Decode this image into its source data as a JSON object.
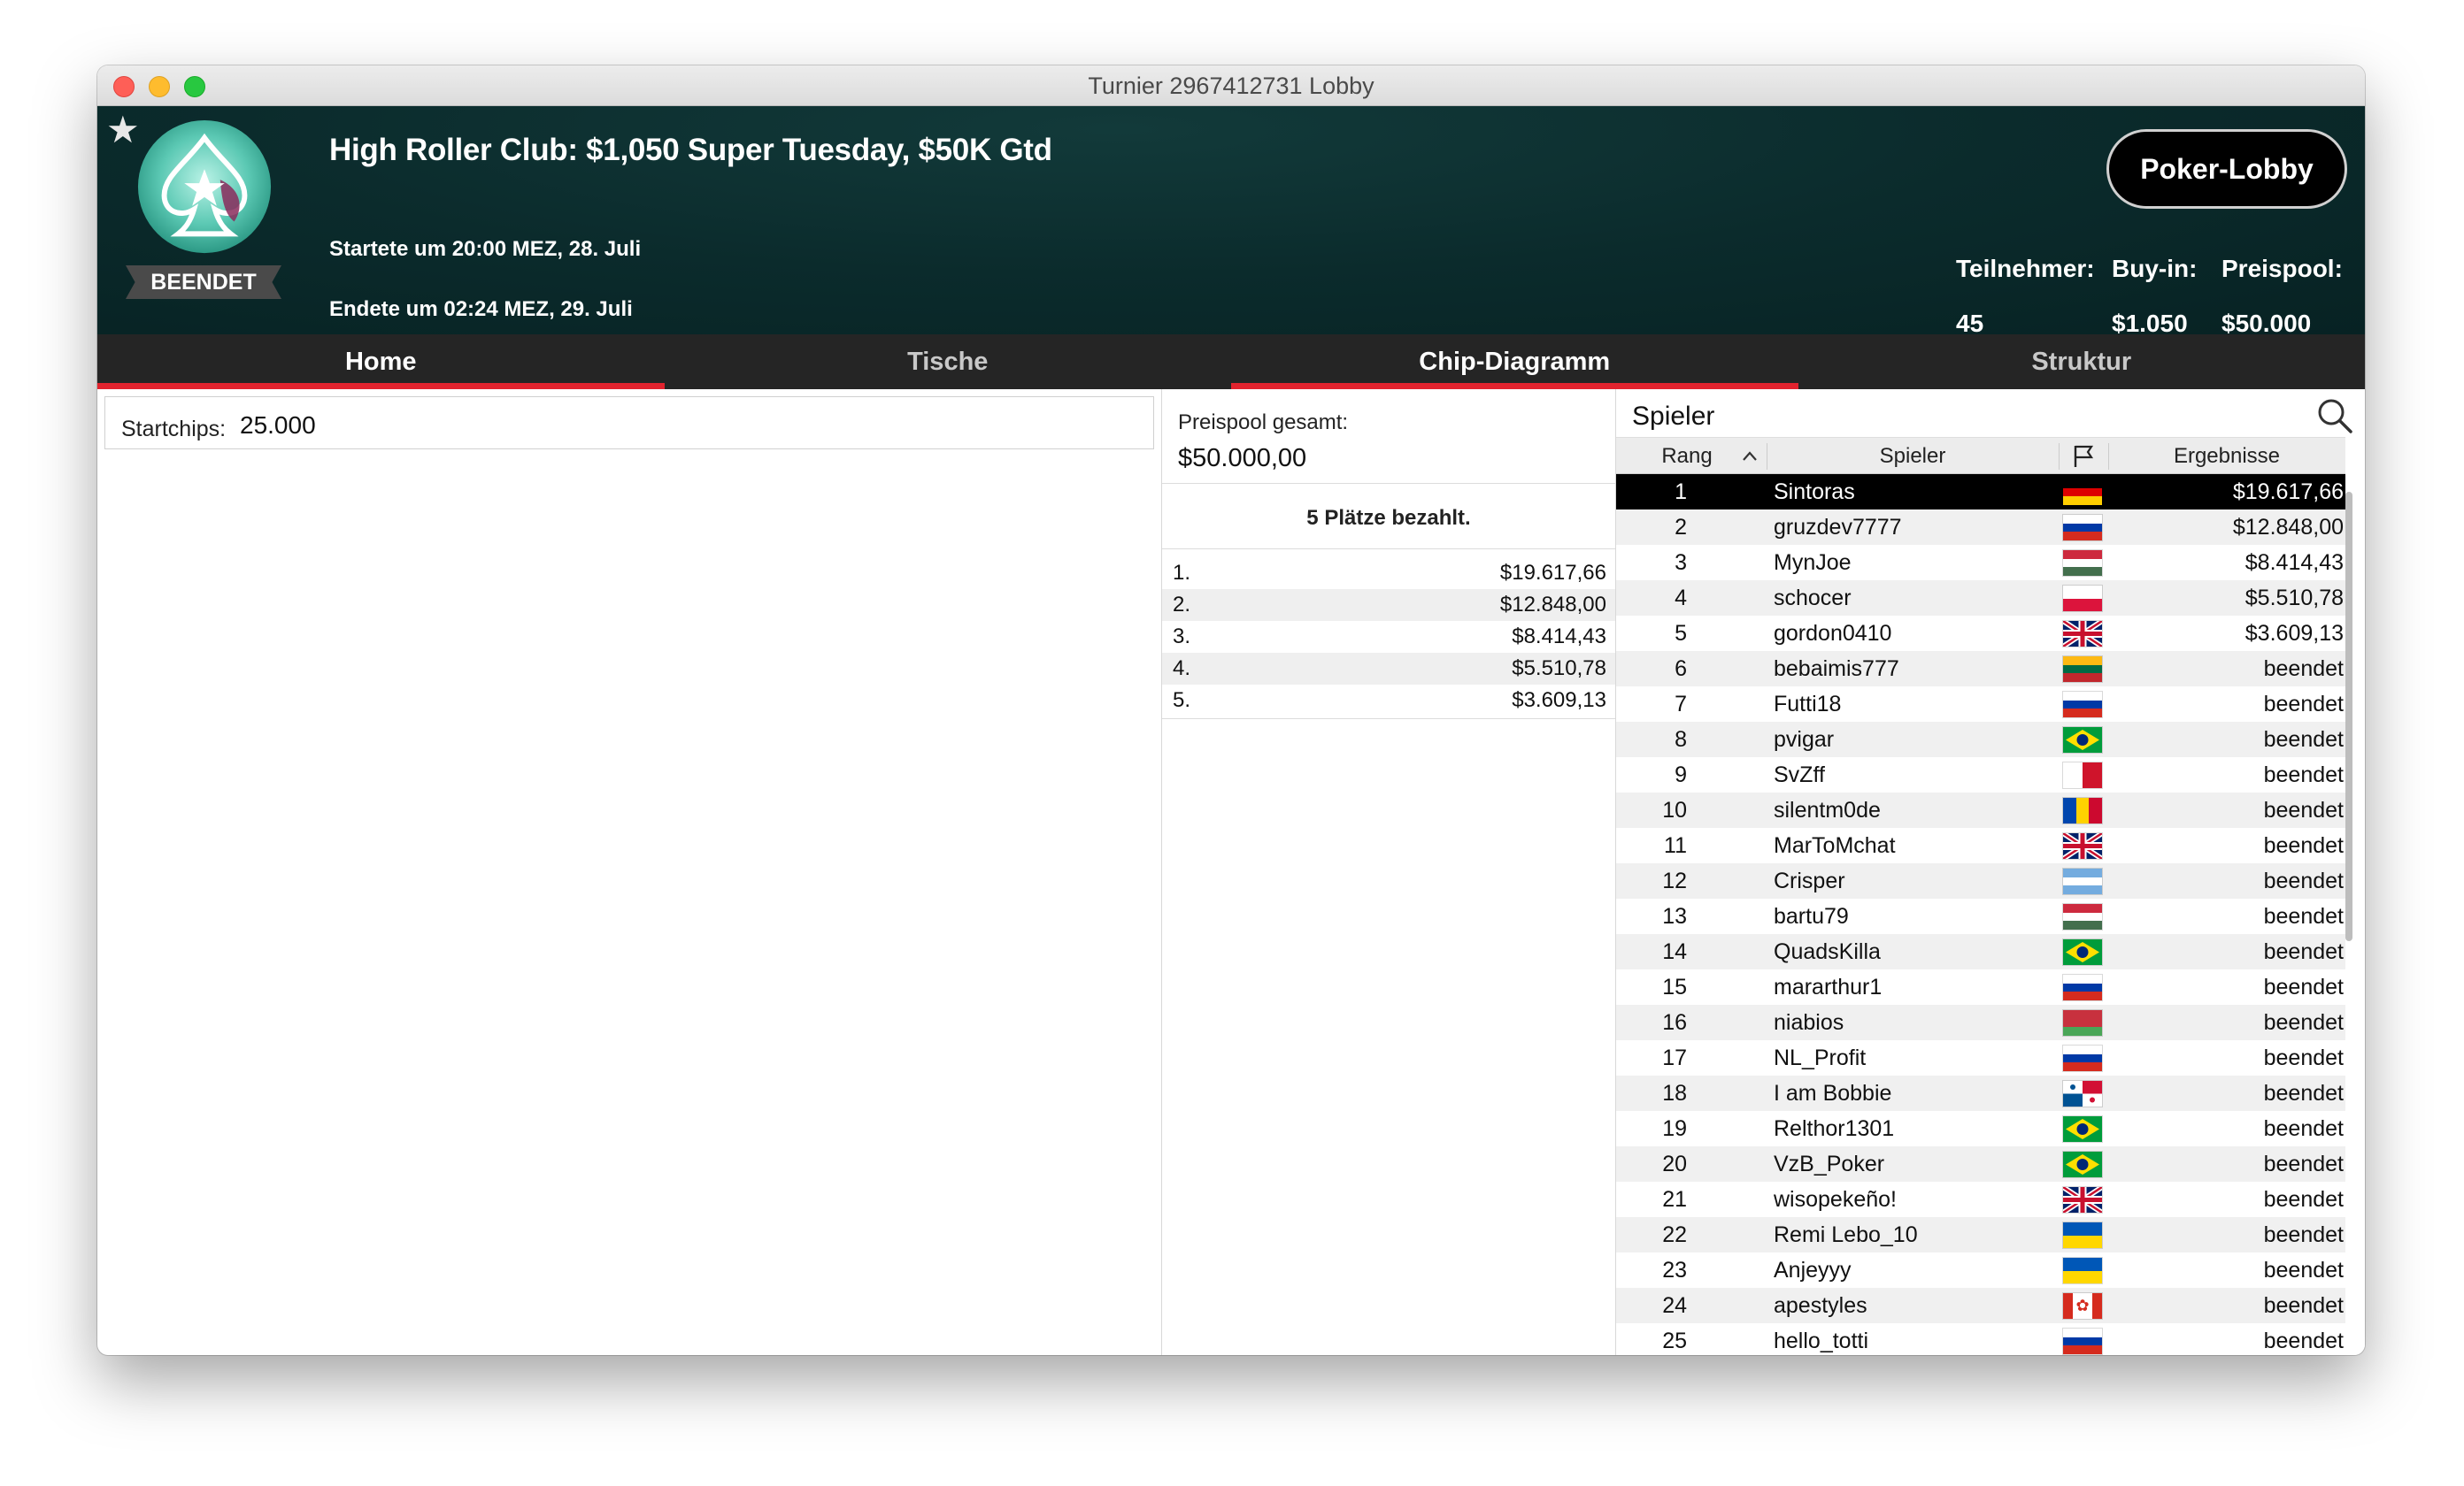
{
  "window": {
    "title": "Turnier 2967412731 Lobby"
  },
  "header": {
    "status": "BEENDET",
    "event_title": "High Roller Club: $1,050 Super Tuesday, $50K Gtd",
    "start": "Startete um 20:00 MEZ, 28. Juli",
    "end": "Endete um 02:24 MEZ, 29. Juli",
    "lobby_button": "Poker-Lobby",
    "stats": [
      {
        "label": "Teilnehmer:",
        "value": "45"
      },
      {
        "label": "Buy-in:",
        "value": "$1.050"
      },
      {
        "label": "Preispool:",
        "value": "$50.000"
      }
    ],
    "icons": {
      "favorite": "star-icon",
      "logo": "spade-logo-icon"
    }
  },
  "tabs": [
    {
      "label": "Home",
      "active": true
    },
    {
      "label": "Tische",
      "active": false
    },
    {
      "label": "Chip-Diagramm",
      "active": true
    },
    {
      "label": "Struktur",
      "active": false
    }
  ],
  "home": {
    "startchips_label": "Startchips:",
    "startchips_value": "25.000"
  },
  "prizes": {
    "pool_label": "Preispool gesamt:",
    "pool_value": "$50.000,00",
    "paid_text": "5 Plätze bezahlt.",
    "list": [
      {
        "place": "1.",
        "amount": "$19.617,66"
      },
      {
        "place": "2.",
        "amount": "$12.848,00"
      },
      {
        "place": "3.",
        "amount": "$8.414,43"
      },
      {
        "place": "4.",
        "amount": "$5.510,78"
      },
      {
        "place": "5.",
        "amount": "$3.609,13"
      }
    ]
  },
  "players": {
    "title": "Spieler",
    "columns": {
      "rank": "Rang",
      "player": "Spieler",
      "result": "Ergebnisse"
    },
    "sort_icon": "chevron-up-icon",
    "flag_header_icon": "flag-icon",
    "search_icon": "search-icon",
    "accent_colors": {
      "brand_red": "#e2232e",
      "header_bg": "#0b2b2c"
    },
    "rows": [
      {
        "rank": "1",
        "name": "Sintoras",
        "flag": "de",
        "result": "$19.617,66",
        "selected": true
      },
      {
        "rank": "2",
        "name": "gruzdev7777",
        "flag": "ru",
        "result": "$12.848,00"
      },
      {
        "rank": "3",
        "name": "MynJoe",
        "flag": "hu",
        "result": "$8.414,43"
      },
      {
        "rank": "4",
        "name": "schocer",
        "flag": "pl",
        "result": "$5.510,78"
      },
      {
        "rank": "5",
        "name": "gordon0410",
        "flag": "gb",
        "result": "$3.609,13"
      },
      {
        "rank": "6",
        "name": "bebaimis777",
        "flag": "lt",
        "result": "beendet"
      },
      {
        "rank": "7",
        "name": "Futti18",
        "flag": "ru",
        "result": "beendet"
      },
      {
        "rank": "8",
        "name": "pvigar",
        "flag": "br",
        "result": "beendet"
      },
      {
        "rank": "9",
        "name": "SvZff",
        "flag": "mt",
        "result": "beendet"
      },
      {
        "rank": "10",
        "name": "silentm0de",
        "flag": "md",
        "result": "beendet"
      },
      {
        "rank": "11",
        "name": "MarToMchat",
        "flag": "gb",
        "result": "beendet"
      },
      {
        "rank": "12",
        "name": "Crisper",
        "flag": "ar",
        "result": "beendet"
      },
      {
        "rank": "13",
        "name": "bartu79",
        "flag": "hu",
        "result": "beendet"
      },
      {
        "rank": "14",
        "name": "QuadsKilla",
        "flag": "br",
        "result": "beendet"
      },
      {
        "rank": "15",
        "name": "mararthur1",
        "flag": "ru",
        "result": "beendet"
      },
      {
        "rank": "16",
        "name": "niabios",
        "flag": "by",
        "result": "beendet"
      },
      {
        "rank": "17",
        "name": "NL_Profit",
        "flag": "ru",
        "result": "beendet"
      },
      {
        "rank": "18",
        "name": "I am Bobbie",
        "flag": "pa",
        "result": "beendet"
      },
      {
        "rank": "19",
        "name": "Relthor1301",
        "flag": "br",
        "result": "beendet"
      },
      {
        "rank": "20",
        "name": "VzB_Poker",
        "flag": "br",
        "result": "beendet"
      },
      {
        "rank": "21",
        "name": "wisopekeño!",
        "flag": "gb",
        "result": "beendet"
      },
      {
        "rank": "22",
        "name": "Remi Lebo_10",
        "flag": "ua",
        "result": "beendet"
      },
      {
        "rank": "23",
        "name": "Anjeyyy",
        "flag": "ua",
        "result": "beendet"
      },
      {
        "rank": "24",
        "name": "apestyles",
        "flag": "ca",
        "result": "beendet"
      },
      {
        "rank": "25",
        "name": "hello_totti",
        "flag": "ru",
        "result": "beendet"
      }
    ]
  }
}
